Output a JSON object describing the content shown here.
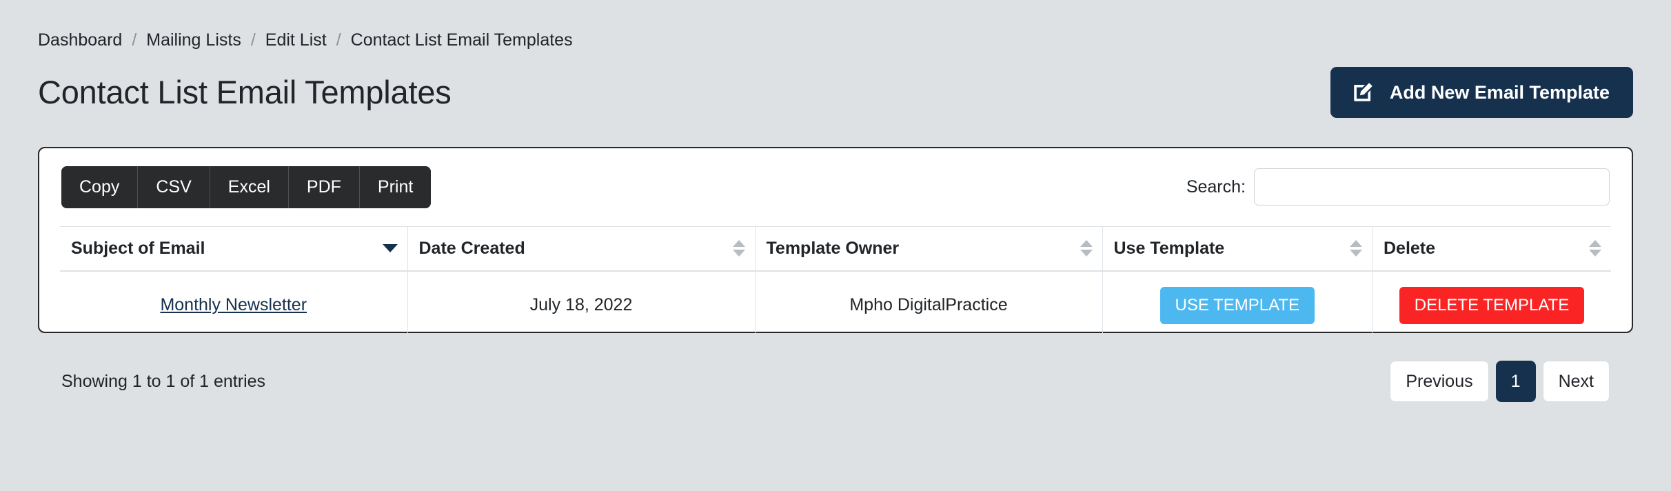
{
  "breadcrumb": {
    "separator": "/",
    "items": [
      {
        "label": "Dashboard"
      },
      {
        "label": "Mailing Lists"
      },
      {
        "label": "Edit List"
      },
      {
        "label": "Contact List Email Templates"
      }
    ]
  },
  "header": {
    "title": "Contact List Email Templates",
    "add_button": {
      "label": "Add New Email Template",
      "icon": "edit-square-pencil-icon",
      "color": "#16314e"
    }
  },
  "toolbar": {
    "export_buttons": [
      {
        "label": "Copy"
      },
      {
        "label": "CSV"
      },
      {
        "label": "Excel"
      },
      {
        "label": "PDF"
      },
      {
        "label": "Print"
      }
    ],
    "search": {
      "label": "Search:",
      "value": "",
      "placeholder": ""
    }
  },
  "table": {
    "columns": [
      {
        "label": "Subject of Email",
        "sort": "desc"
      },
      {
        "label": "Date Created",
        "sort": "none"
      },
      {
        "label": "Template Owner",
        "sort": "none"
      },
      {
        "label": "Use Template",
        "sort": "none"
      },
      {
        "label": "Delete",
        "sort": "none"
      }
    ],
    "rows": [
      {
        "subject": "Monthly Newsletter",
        "date_created": "July 18, 2022",
        "template_owner": "Mpho DigitalPractice",
        "use_label": "USE TEMPLATE",
        "delete_label": "DELETE TEMPLATE"
      }
    ]
  },
  "footer": {
    "entries_info": "Showing 1 to 1 of 1 entries",
    "pagination": {
      "previous": "Previous",
      "pages": [
        {
          "label": "1",
          "active": true
        }
      ],
      "next": "Next"
    }
  },
  "colors": {
    "page_background": "#dde1e3",
    "accent_dark": "#16314e",
    "use_button": "#4db8f0",
    "delete_button": "#fa2424",
    "export_group": "#2a2b2c"
  }
}
